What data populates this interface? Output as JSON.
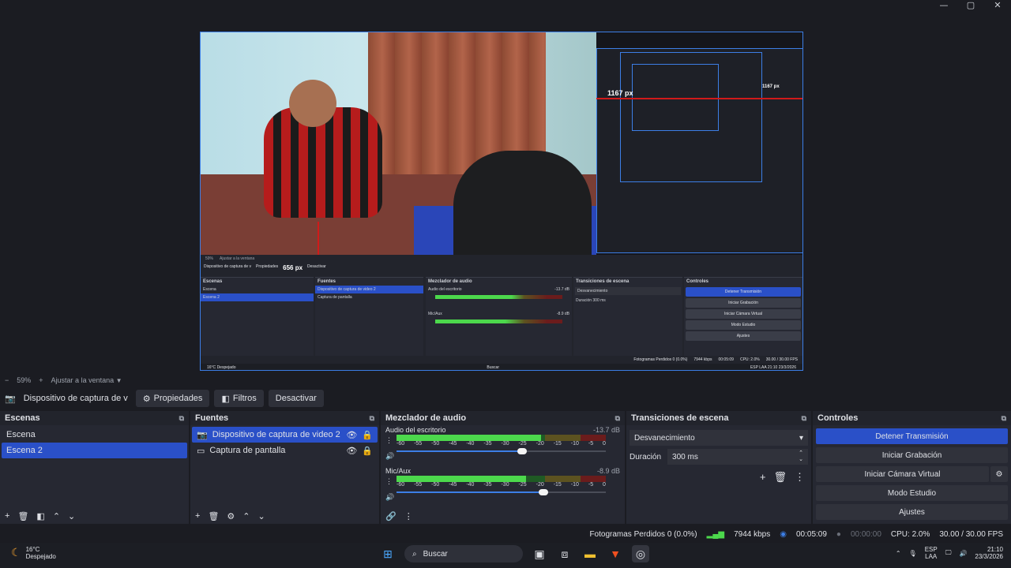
{
  "window": {
    "minimize": "—",
    "maximize": "▢",
    "close": "✕"
  },
  "preview": {
    "px_label_large": "1167 px",
    "px_label_small": "1167 px",
    "px_label_mid": "656 px",
    "inner": {
      "zoom": "59%",
      "fit": "Ajustar a la ventana",
      "source": "Dispositivo de captura de v",
      "properties": "Propiedades",
      "filters": "Filtros",
      "deactivate": "Desactivar",
      "scenes_title": "Escenas",
      "sources_title": "Fuentes",
      "mixer_title": "Mezclador de audio",
      "transitions_title": "Transiciones de escena",
      "controls_title": "Controles",
      "scene1": "Escena",
      "scene2": "Escena 2",
      "src1": "Dispositivo de captura de video 2",
      "src2": "Captura de pantalla",
      "aud1": "Audio del escritorio",
      "aud1_db": "-13.7 dB",
      "aud2": "Mic/Aux",
      "aud2_db": "-8.9 dB",
      "fade": "Desvanecimiento",
      "dur_label": "Duración",
      "dur_val": "300 ms",
      "c1": "Detener Transmisión",
      "c2": "Iniciar Grabación",
      "c3": "Iniciar Cámara Virtual",
      "c4": "Modo Estudio",
      "c5": "Ajustes",
      "status": "Fotogramas Perdidos 0 (0.0%)",
      "kbps": "7944 kbps",
      "time": "00:05:09",
      "cpu": "CPU: 2.0%",
      "fps": "30.00 / 30.00 FPS",
      "temp": "16°C",
      "weather": "Despejado",
      "search": "Buscar",
      "clock": "21:10",
      "date": "23/3/2026",
      "lang1": "ESP",
      "lang2": "LAA"
    }
  },
  "zoombar": {
    "minus": "−",
    "zoom": "59%",
    "plus": "+",
    "fit": "Ajustar a la ventana"
  },
  "sourcebar": {
    "source_name": "Dispositivo de captura de v",
    "properties": "Propiedades",
    "filters": "Filtros",
    "deactivate": "Desactivar"
  },
  "scenes": {
    "title": "Escenas",
    "items": [
      "Escena",
      "Escena 2"
    ],
    "selected": 1
  },
  "sources": {
    "title": "Fuentes",
    "items": [
      "Dispositivo de captura de video 2",
      "Captura de pantalla"
    ],
    "selected": 0
  },
  "mixer": {
    "title": "Mezclador de audio",
    "ticks": [
      "-60",
      "-55",
      "-50",
      "-45",
      "-40",
      "-35",
      "-30",
      "-25",
      "-20",
      "-15",
      "-10",
      "-5",
      "0"
    ],
    "channels": [
      {
        "name": "Audio del escritorio",
        "db": "-13.7 dB",
        "level": 0.69,
        "volume": 0.6
      },
      {
        "name": "Mic/Aux",
        "db": "-8.9 dB",
        "level": 0.62,
        "volume": 0.7
      }
    ]
  },
  "transitions": {
    "title": "Transiciones de escena",
    "selected": "Desvanecimiento",
    "duration_label": "Duración",
    "duration_value": "300 ms"
  },
  "controls": {
    "title": "Controles",
    "stop_stream": "Detener Transmisión",
    "start_record": "Iniciar Grabación",
    "virtual_cam": "Iniciar Cámara Virtual",
    "studio_mode": "Modo Estudio",
    "settings": "Ajustes"
  },
  "status": {
    "dropped": "Fotogramas Perdidos 0 (0.0%)",
    "kbps": "7944 kbps",
    "live_time": "00:05:09",
    "rec_time": "00:00:00",
    "cpu": "CPU: 2.0%",
    "fps": "30.00 / 30.00 FPS"
  },
  "taskbar": {
    "temp": "16°C",
    "weather": "Despejado",
    "search": "Buscar",
    "lang1": "ESP",
    "lang2": "LAA",
    "time": "21:10",
    "date": "23/3/2026"
  },
  "colors": {
    "accent": "#2a50c8",
    "preview_border": "#3c7ee6",
    "guide_red": "#d01a1a",
    "meter_green": "#4cd84c"
  }
}
